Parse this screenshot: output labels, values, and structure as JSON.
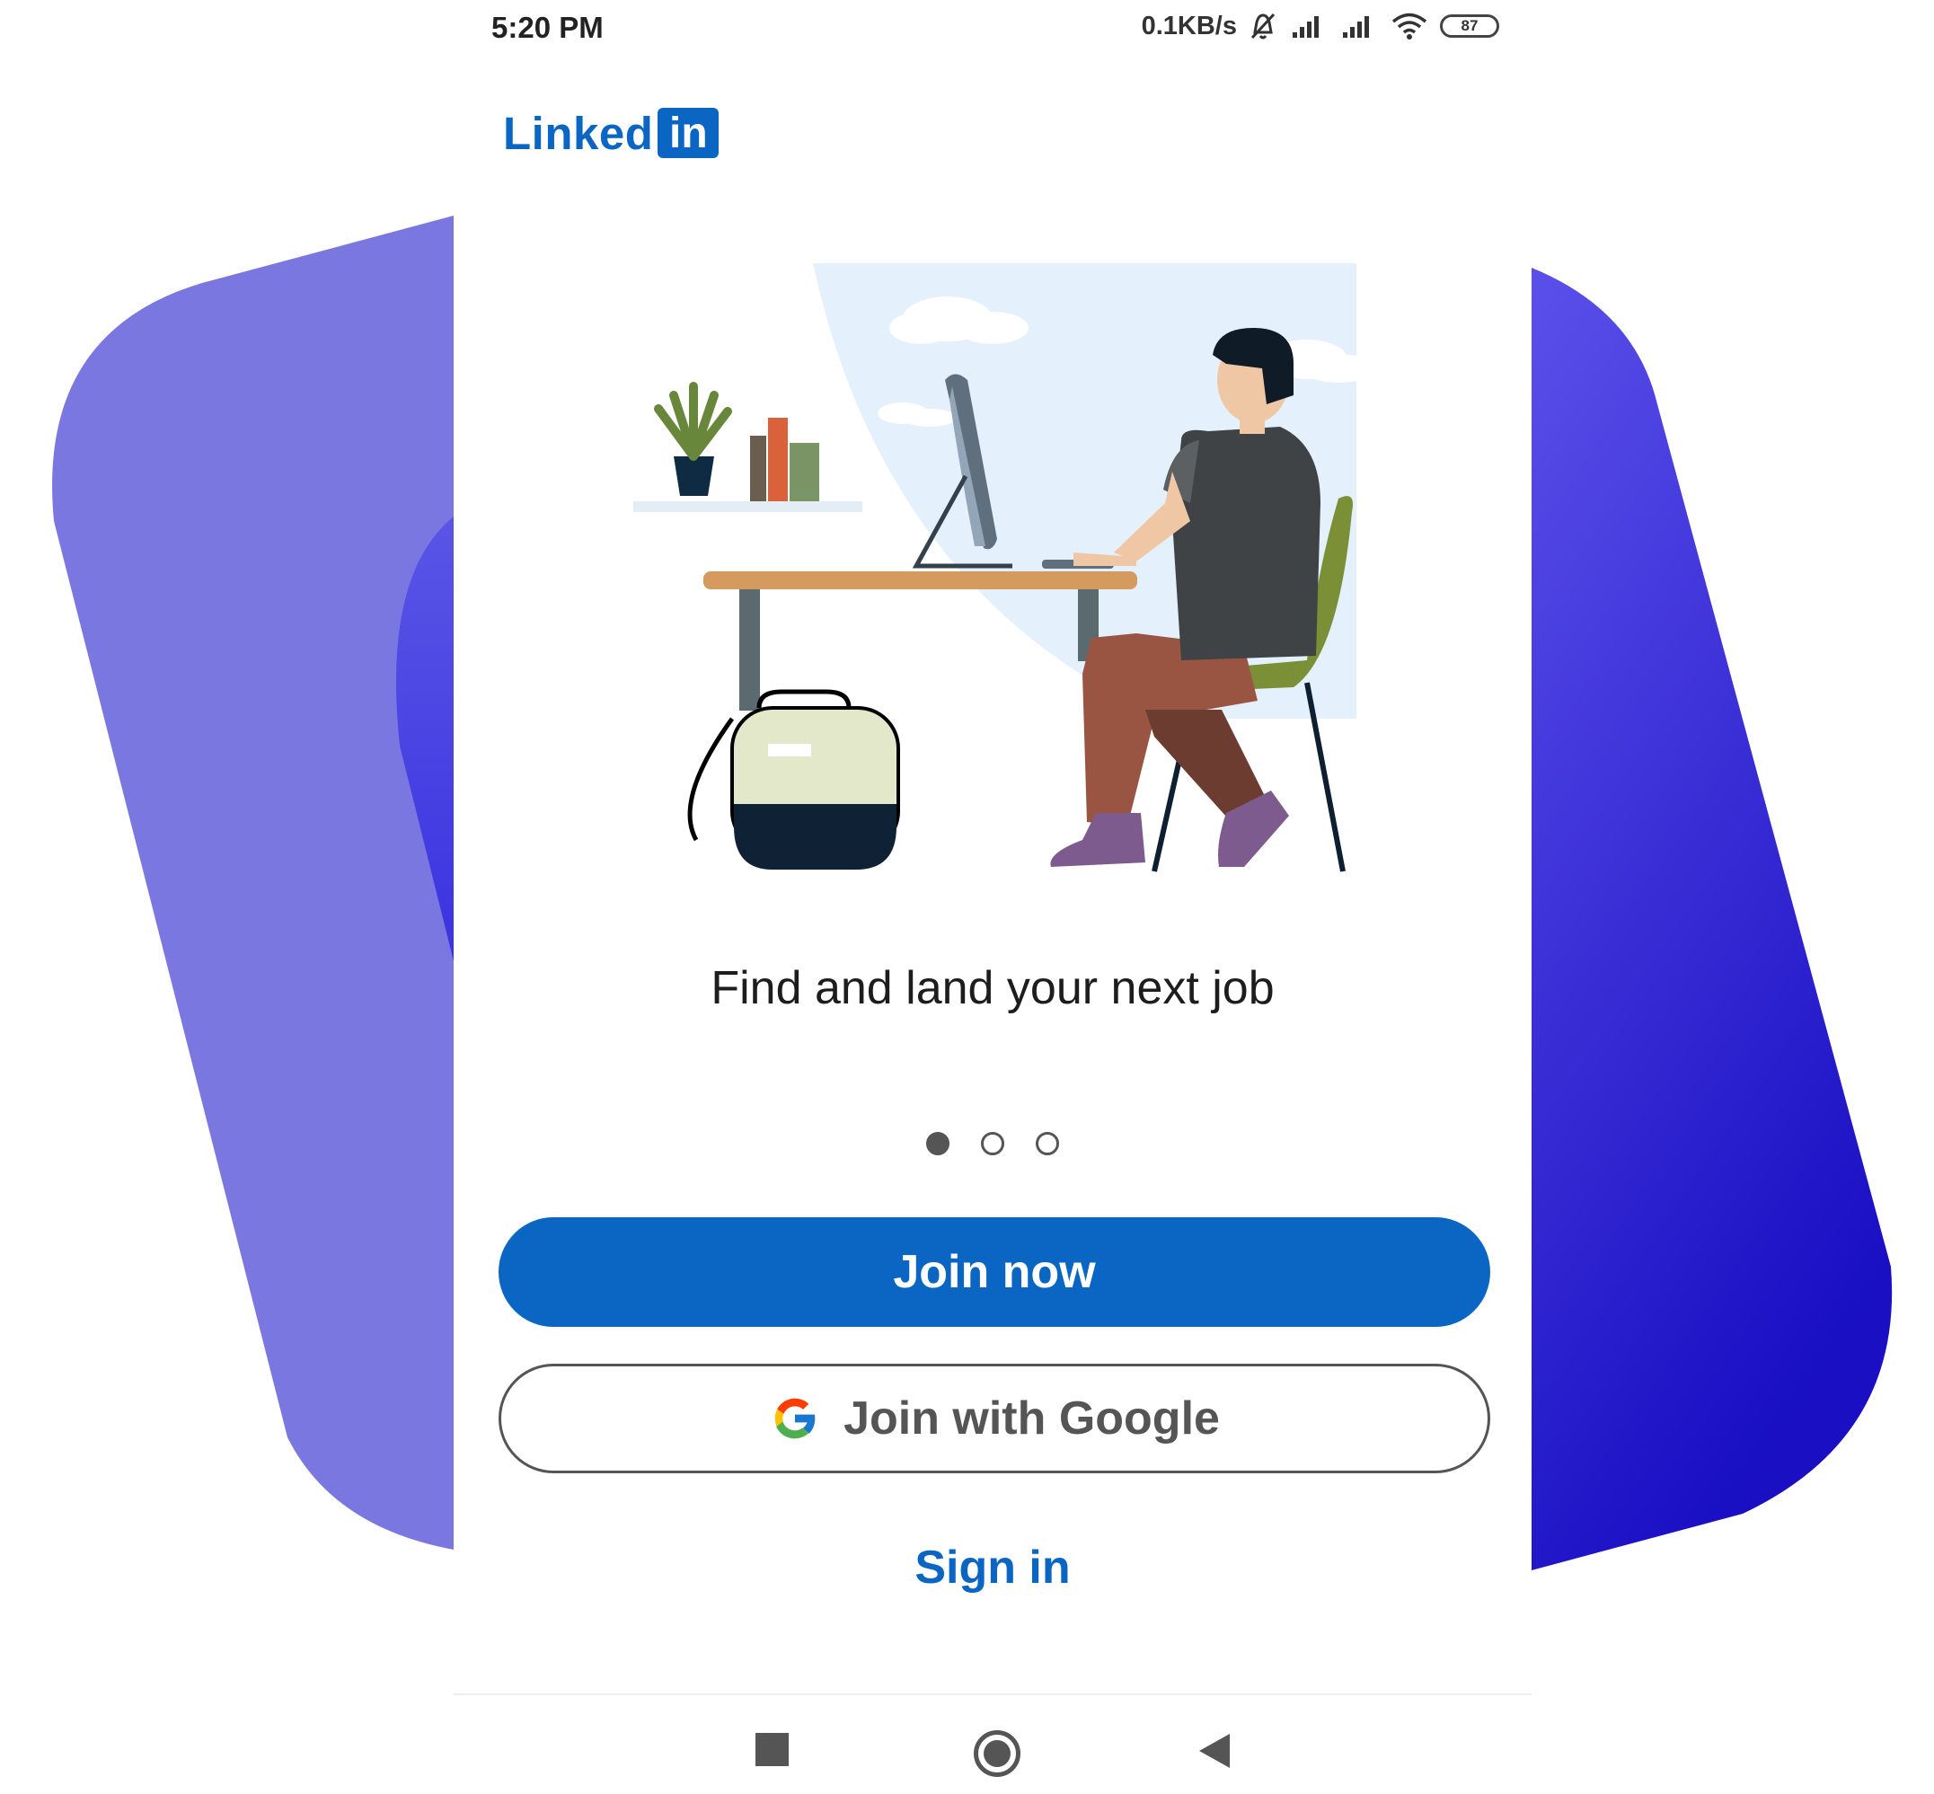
{
  "status_bar": {
    "time": "5:20 PM",
    "network_speed": "0.1KB/s",
    "battery": "87"
  },
  "logo": {
    "text": "Linked",
    "box_text": "in",
    "color": "#0a66c2"
  },
  "headline": "Find and land your next job",
  "carousel": {
    "total": 3,
    "active_index": 0
  },
  "buttons": {
    "join_now": "Join now",
    "join_google": "Join with Google",
    "sign_in": "Sign in"
  },
  "colors": {
    "brand": "#0a66c2",
    "bg_left": "#7a77e0",
    "bg_right_top": "#5a4fe8",
    "bg_right_bottom": "#1c0fc4"
  },
  "icons": {
    "status": [
      "mute-bell-icon",
      "signal-icon",
      "signal-icon",
      "wifi-icon",
      "battery-icon"
    ],
    "google": "google-g-icon",
    "nav": [
      "recents-square-icon",
      "home-circle-icon",
      "back-triangle-icon"
    ]
  }
}
